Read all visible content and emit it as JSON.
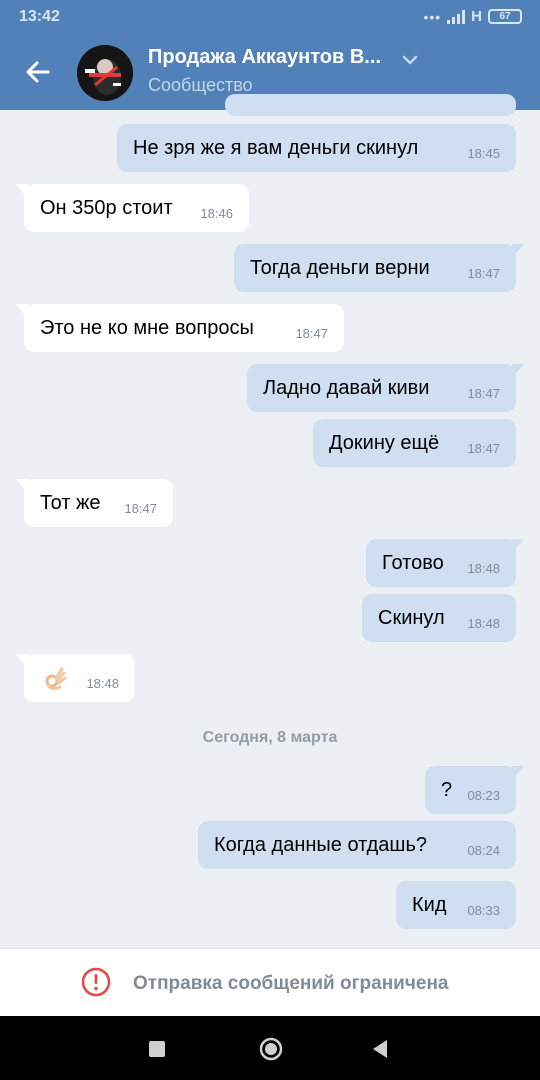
{
  "status_bar": {
    "time": "13:42",
    "network": "H",
    "battery": "67"
  },
  "header": {
    "title": "Продажа Аккаунтов В...",
    "subtitle": "Сообщество"
  },
  "messages": [
    {
      "text": "Не зря же я вам деньги скинул",
      "time": "18:45",
      "direction": "out"
    },
    {
      "text": "Он 350р стоит",
      "time": "18:46",
      "direction": "in"
    },
    {
      "text": "Тогда деньги верни",
      "time": "18:47",
      "direction": "out"
    },
    {
      "text": "Это не ко мне вопросы",
      "time": "18:47",
      "direction": "in"
    },
    {
      "text": "Ладно давай киви",
      "time": "18:47",
      "direction": "out"
    },
    {
      "text": "Докину ещё",
      "time": "18:47",
      "direction": "out"
    },
    {
      "text": "Тот же",
      "time": "18:47",
      "direction": "in"
    },
    {
      "text": "Готово",
      "time": "18:48",
      "direction": "out"
    },
    {
      "text": "Скинул",
      "time": "18:48",
      "direction": "out"
    },
    {
      "text": "",
      "emoji": "ok-hand",
      "time": "18:48",
      "direction": "in"
    },
    {
      "text": "?",
      "time": "08:23",
      "direction": "out"
    },
    {
      "text": "Когда данные отдашь?",
      "time": "08:24",
      "direction": "out"
    },
    {
      "text": "Кид",
      "time": "08:33",
      "direction": "out"
    }
  ],
  "date_separator": "Сегодня, 8 марта",
  "footer": {
    "notice": "Отправка сообщений ограничена"
  },
  "colors": {
    "header": "#5181b8",
    "outgoing_bubble": "#cfdff1",
    "incoming_bubble": "#ffffff",
    "background": "#ecf0f4",
    "warning": "#e64646"
  }
}
